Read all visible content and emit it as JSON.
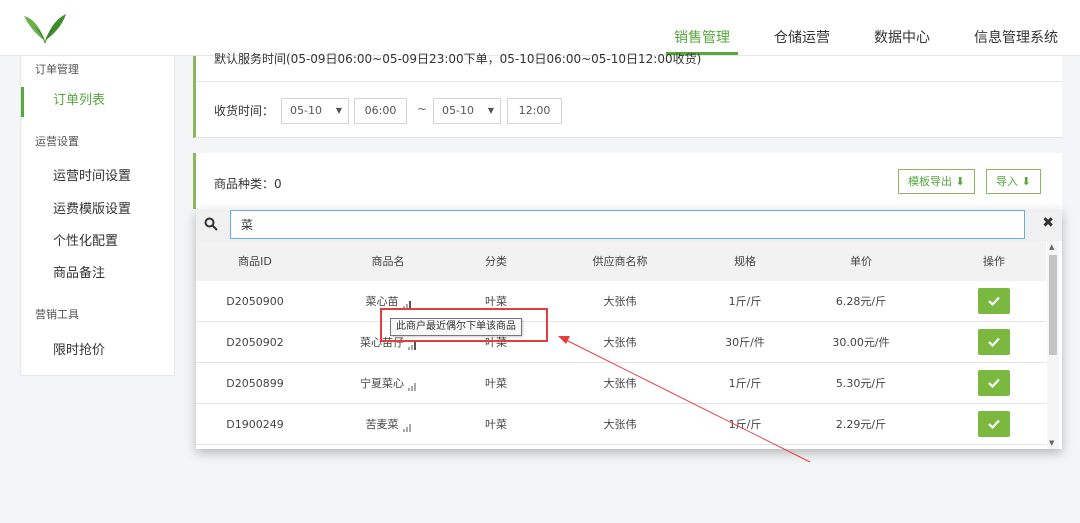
{
  "nav": {
    "items": [
      {
        "label": "销售管理",
        "active": true
      },
      {
        "label": "仓储运营",
        "active": false
      },
      {
        "label": "数据中心",
        "active": false
      },
      {
        "label": "信息管理系统",
        "active": false
      }
    ]
  },
  "sidebar": {
    "groups": [
      {
        "label": "订单管理",
        "items": [
          {
            "label": "订单列表",
            "active": true
          }
        ]
      },
      {
        "label": "运营设置",
        "items": [
          {
            "label": "运营时间设置"
          },
          {
            "label": "运费模版设置"
          },
          {
            "label": "个性化配置"
          },
          {
            "label": "商品备注"
          }
        ]
      },
      {
        "label": "营销工具",
        "items": [
          {
            "label": "限时抢价"
          }
        ]
      }
    ]
  },
  "panel1": {
    "notice": "默认服务时间(05-09日06:00~05-09日23:00下单，05-10日06:00~05-10日12:00收货)",
    "receive_label": "收货时间：",
    "start_date": "05-10",
    "start_time": "06:00",
    "separator": "~",
    "end_date": "05-10",
    "end_time": "12:00"
  },
  "panel2": {
    "kinds_label": "商品种类：0",
    "export_label": "模板导出",
    "import_label": "导入"
  },
  "search": {
    "value": "菜"
  },
  "table": {
    "headers": [
      "商品ID",
      "商品名",
      "分类",
      "供应商名称",
      "规格",
      "单价",
      "操作"
    ],
    "rows": [
      {
        "id": "D2050900",
        "name": "菜心苗",
        "category": "叶菜",
        "supplier": "大张伟",
        "spec": "1斤/斤",
        "price": "6.28元/斤"
      },
      {
        "id": "D2050902",
        "name": "菜心苗仔",
        "category": "叶菜",
        "supplier": "大张伟",
        "spec": "30斤/件",
        "price": "30.00元/件"
      },
      {
        "id": "D2050899",
        "name": "宁夏菜心",
        "category": "叶菜",
        "supplier": "大张伟",
        "spec": "1斤/斤",
        "price": "5.30元/斤"
      },
      {
        "id": "D1900249",
        "name": "苦麦菜",
        "category": "叶菜",
        "supplier": "大张伟",
        "spec": "1斤/斤",
        "price": "2.29元/斤"
      }
    ]
  },
  "tooltip": {
    "text": "此商户最近偶尔下单该商品"
  },
  "colors": {
    "accent": "#56a83b",
    "button": "#7ab83f",
    "annotation": "#e53c3c"
  }
}
